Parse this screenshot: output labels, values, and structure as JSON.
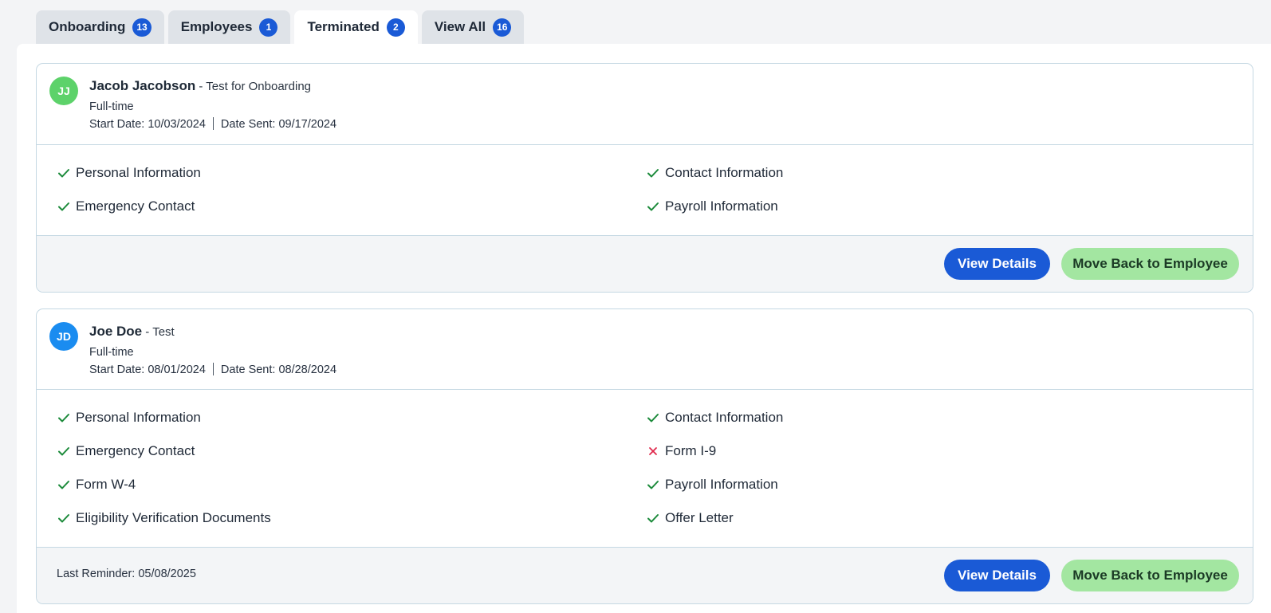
{
  "tabs": [
    {
      "label": "Onboarding",
      "count": "13",
      "active": false
    },
    {
      "label": "Employees",
      "count": "1",
      "active": false
    },
    {
      "label": "Terminated",
      "count": "2",
      "active": true
    },
    {
      "label": "View All",
      "count": "16",
      "active": false
    }
  ],
  "cards": [
    {
      "initials": "JJ",
      "avatar_color": "#5dd26a",
      "name": "Jacob Jacobson",
      "role": " - Test for Onboarding",
      "employment_type": "Full-time",
      "start_date": "Start Date: 10/03/2024",
      "date_sent": "Date Sent: 09/17/2024",
      "checklist": [
        {
          "label": "Personal Information",
          "status": "complete"
        },
        {
          "label": "Contact Information",
          "status": "complete"
        },
        {
          "label": "Emergency Contact",
          "status": "complete"
        },
        {
          "label": "Payroll Information",
          "status": "complete"
        }
      ],
      "last_reminder": "",
      "view_details_label": "View Details",
      "move_back_label": "Move Back to Employee"
    },
    {
      "initials": "JD",
      "avatar_color": "#1a8cf0",
      "name": "Joe Doe",
      "role": " - Test",
      "employment_type": "Full-time",
      "start_date": "Start Date: 08/01/2024",
      "date_sent": "Date Sent: 08/28/2024",
      "checklist": [
        {
          "label": "Personal Information",
          "status": "complete"
        },
        {
          "label": "Contact Information",
          "status": "complete"
        },
        {
          "label": "Emergency Contact",
          "status": "complete"
        },
        {
          "label": "Form I-9",
          "status": "incomplete"
        },
        {
          "label": "Form W-4",
          "status": "complete"
        },
        {
          "label": "Payroll Information",
          "status": "complete"
        },
        {
          "label": "Eligibility Verification Documents",
          "status": "complete"
        },
        {
          "label": "Offer Letter",
          "status": "complete"
        }
      ],
      "last_reminder": "Last Reminder: 05/08/2025",
      "view_details_label": "View Details",
      "move_back_label": "Move Back to Employee"
    }
  ],
  "colors": {
    "primary": "#1a5ad6",
    "success_button": "#a3e6a1",
    "check": "#1b8a3a",
    "cross": "#e0284b"
  }
}
